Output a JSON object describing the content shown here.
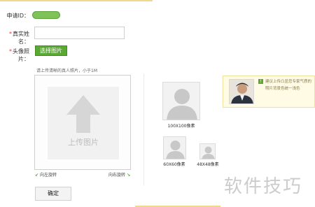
{
  "form": {
    "id_label": "申请ID：",
    "name_label": "真实姓名：",
    "photo_label": "头像照片：",
    "required_mark": "*",
    "name_value": "",
    "choose_button": "选择图片",
    "hint": "请上传清晰的真人照片，小于1M",
    "upload_label": "上传图片",
    "rotate_left": "向左旋转",
    "rotate_right": "向右旋转",
    "confirm_button": "确定"
  },
  "previews": [
    {
      "caption": "100X100像素"
    },
    {
      "caption": "60X60像素"
    },
    {
      "caption": "48X48像素"
    }
  ],
  "tip": {
    "icon": "!",
    "text": "建议上传凸显您专家气质的照片背景色统一浅色"
  },
  "watermark": "软件技巧",
  "colors": {
    "accent": "#5aa932",
    "id_pill": "#7fc25a"
  }
}
